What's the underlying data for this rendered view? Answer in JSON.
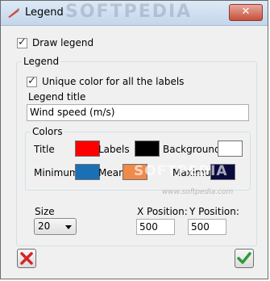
{
  "window": {
    "title": "Legend",
    "watermark": "SOFTPEDIA",
    "close_label": "✕"
  },
  "draw_legend": {
    "label": "Draw legend",
    "checked": true
  },
  "legend_group": {
    "title": "Legend",
    "unique_color": {
      "label": "Unique color for all the labels",
      "checked": true
    },
    "legend_title_label": "Legend title",
    "legend_title_value": "Wind speed (m/s)"
  },
  "colors_group": {
    "title": "Colors",
    "items": [
      {
        "label": "Title",
        "color": "#ff0000"
      },
      {
        "label": "Labels",
        "color": "#000000"
      },
      {
        "label": "Background",
        "color": "#ffffff"
      },
      {
        "label": "Minimum",
        "color": "#1a6fb5"
      },
      {
        "label": "Mean",
        "color": "#f08a4b"
      },
      {
        "label": "Maximum",
        "color": "#0a0a40"
      }
    ],
    "watermark": "SOFTPEDIA",
    "site_watermark": "www.softpedia.com"
  },
  "size": {
    "label": "Size",
    "value": "20"
  },
  "x_position": {
    "label": "X Position:",
    "value": "500"
  },
  "y_position": {
    "label": "Y Position:",
    "value": "500"
  },
  "buttons": {
    "cancel_icon": "cross-icon",
    "ok_icon": "checkmark-icon"
  }
}
